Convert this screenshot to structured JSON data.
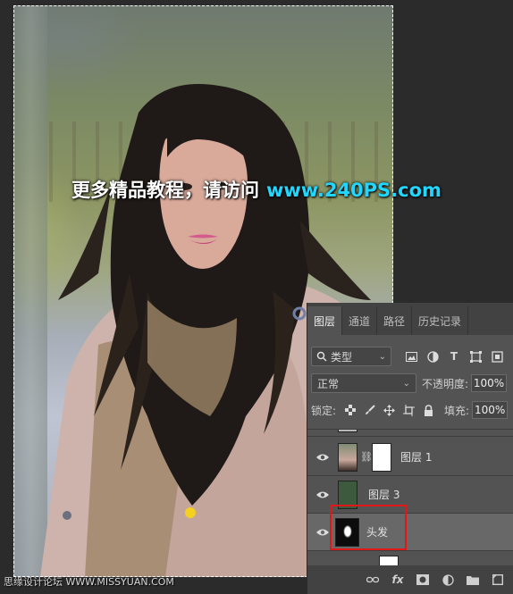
{
  "watermark": {
    "text": "更多精品教程，请访问",
    "url": "www.240PS.com"
  },
  "footer_watermark": "思缘设计论坛 WWW.MISSYUAN.COM",
  "layers_panel": {
    "tabs": [
      {
        "label": "图层",
        "active": true
      },
      {
        "label": "通道",
        "active": false
      },
      {
        "label": "路径",
        "active": false
      },
      {
        "label": "历史记录",
        "active": false
      }
    ],
    "filter_kind": "类型",
    "filter_icons": [
      "image-filter-icon",
      "adjustment-filter-icon",
      "type-filter-icon",
      "shape-filter-icon",
      "smart-object-filter-icon"
    ],
    "blend_mode": "正常",
    "opacity_label": "不透明度:",
    "opacity_value": "100%",
    "lock_label": "锁定:",
    "lock_icons": [
      "lock-transparent-icon",
      "lock-brush-icon",
      "lock-move-icon",
      "lock-artboard-icon",
      "lock-all-icon"
    ],
    "fill_label": "填充:",
    "fill_value": "100%",
    "layers": [
      {
        "name": "图层 1",
        "visible": true,
        "has_mask": true,
        "selected": false
      },
      {
        "name": "图层 3",
        "visible": true,
        "has_mask": false,
        "selected": false,
        "thumb_color": "#3d5a3f"
      },
      {
        "name": "头发",
        "visible": true,
        "has_mask": false,
        "selected": true
      }
    ],
    "bottom_icons": [
      "link-layers-icon",
      "fx-icon",
      "add-mask-icon",
      "adjustment-layer-icon",
      "group-folder-icon",
      "new-layer-icon"
    ],
    "fx_label": "fx"
  },
  "colors": {
    "panel_bg": "#535353",
    "tab_bar_bg": "#424242",
    "selected_layer_bg": "#686868",
    "highlight_border": "#e01818",
    "url_color": "#21d7ff"
  }
}
